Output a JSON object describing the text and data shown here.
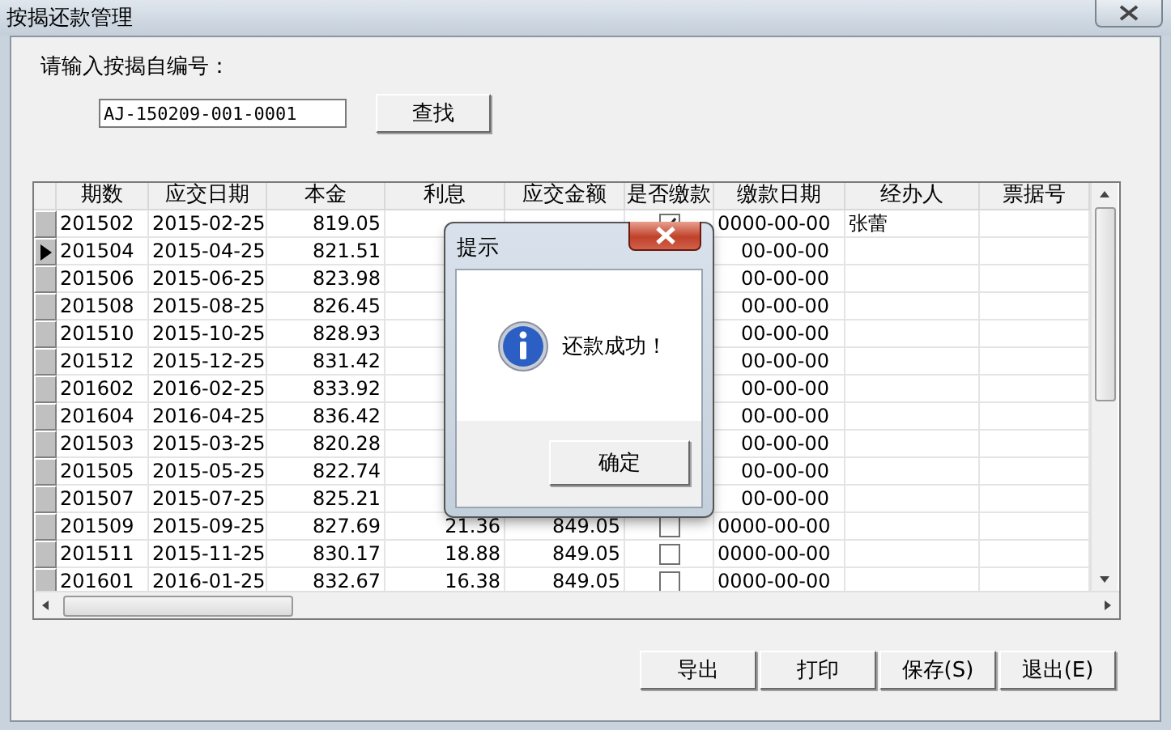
{
  "window": {
    "title": "按揭还款管理"
  },
  "search": {
    "label": "请输入按揭自编号：",
    "value": "AJ-150209-001-0001",
    "button": "查找"
  },
  "table": {
    "columns": [
      "期数",
      "应交日期",
      "本金",
      "利息",
      "应交金额",
      "是否缴款",
      "缴款日期",
      "经办人",
      "票据号"
    ],
    "rows": [
      {
        "period": "201502",
        "due_date": "2015-02-25",
        "principal": "819.05",
        "paid": true,
        "pay_date": "0000-00-00",
        "handler": "张蕾",
        "selected": false
      },
      {
        "period": "201504",
        "due_date": "2015-04-25",
        "principal": "821.51",
        "pay_date": "00-00-00",
        "selected": true
      },
      {
        "period": "201506",
        "due_date": "2015-06-25",
        "principal": "823.98",
        "pay_date": "00-00-00",
        "selected": false
      },
      {
        "period": "201508",
        "due_date": "2015-08-25",
        "principal": "826.45",
        "pay_date": "00-00-00",
        "selected": false
      },
      {
        "period": "201510",
        "due_date": "2015-10-25",
        "principal": "828.93",
        "pay_date": "00-00-00",
        "selected": false
      },
      {
        "period": "201512",
        "due_date": "2015-12-25",
        "principal": "831.42",
        "pay_date": "00-00-00",
        "selected": false
      },
      {
        "period": "201602",
        "due_date": "2016-02-25",
        "principal": "833.92",
        "pay_date": "00-00-00",
        "selected": false
      },
      {
        "period": "201604",
        "due_date": "2016-04-25",
        "principal": "836.42",
        "pay_date": "00-00-00",
        "selected": false
      },
      {
        "period": "201503",
        "due_date": "2015-03-25",
        "principal": "820.28",
        "pay_date": "00-00-00",
        "selected": false
      },
      {
        "period": "201505",
        "due_date": "2015-05-25",
        "principal": "822.74",
        "pay_date": "00-00-00",
        "selected": false
      },
      {
        "period": "201507",
        "due_date": "2015-07-25",
        "principal": "825.21",
        "pay_date": "00-00-00",
        "selected": false
      },
      {
        "period": "201509",
        "due_date": "2015-09-25",
        "principal": "827.69",
        "interest": "21.36",
        "amount": "849.05",
        "paid": false,
        "pay_date": "0000-00-00",
        "selected": false
      },
      {
        "period": "201511",
        "due_date": "2015-11-25",
        "principal": "830.17",
        "interest": "18.88",
        "amount": "849.05",
        "paid": false,
        "pay_date": "0000-00-00",
        "selected": false
      },
      {
        "period": "201601",
        "due_date": "2016-01-25",
        "principal": "832.67",
        "interest": "16.38",
        "amount": "849.05",
        "paid": false,
        "pay_date": "0000-00-00",
        "selected": false
      }
    ]
  },
  "dialog": {
    "title": "提示",
    "message": "还款成功！",
    "button": "确定"
  },
  "buttons": [
    "导出",
    "打印",
    "保存(S)",
    "退出(E)"
  ]
}
